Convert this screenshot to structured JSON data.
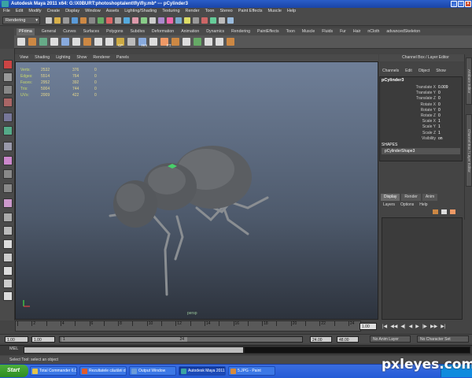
{
  "window": {
    "title": "Autodesk Maya 2011 x64: G:\\X0BURT:photoshoptalent\\fly\\fly.mb*   ---   pCylinder3"
  },
  "menubar": [
    "File",
    "Edit",
    "Modify",
    "Create",
    "Display",
    "Window",
    "Assets",
    "Lighting/Shading",
    "Texturing",
    "Render",
    "Toon",
    "Stereo",
    "Paint Effects",
    "Muscle",
    "Help"
  ],
  "status_line": {
    "mode": "Rendering"
  },
  "shelf_tabs": [
    "PFrima",
    "General",
    "Curves",
    "Surfaces",
    "Polygons",
    "Subdivs",
    "Deformation",
    "Animation",
    "Dynamics",
    "Rendering",
    "PaintEffects",
    "Toon",
    "Muscle",
    "Fluids",
    "Fur",
    "Hair",
    "nCloth",
    "advancedSkeleton"
  ],
  "shelf_icon_labels": [
    "CP",
    "Hrn",
    "FT"
  ],
  "panel_menu": [
    "View",
    "Shading",
    "Lighting",
    "Show",
    "Renderer",
    "Panels"
  ],
  "hud": [
    {
      "label": "Verts:",
      "a": "2532",
      "b": "376",
      "c": "0"
    },
    {
      "label": "Edges:",
      "a": "5514",
      "b": "764",
      "c": "0"
    },
    {
      "label": "Faces:",
      "a": "2952",
      "b": "392",
      "c": "0"
    },
    {
      "label": "Tris:",
      "a": "5004",
      "b": "744",
      "c": "0"
    },
    {
      "label": "UVs:",
      "a": "2009",
      "b": "422",
      "c": "0"
    }
  ],
  "viewport_label": "persp",
  "channel_box": {
    "header": "Channel Box / Layer Editor",
    "menu": [
      "Channels",
      "Edit",
      "Object",
      "Show"
    ],
    "object": "pCylinder3",
    "attrs": [
      {
        "name": "Translate X",
        "value": "0.009"
      },
      {
        "name": "Translate Y",
        "value": "0"
      },
      {
        "name": "Translate Z",
        "value": "0"
      },
      {
        "name": "Rotate X",
        "value": "0"
      },
      {
        "name": "Rotate Y",
        "value": "0"
      },
      {
        "name": "Rotate Z",
        "value": "0"
      },
      {
        "name": "Scale X",
        "value": "1"
      },
      {
        "name": "Scale Y",
        "value": "1"
      },
      {
        "name": "Scale Z",
        "value": "1"
      },
      {
        "name": "Visibility",
        "value": "on"
      }
    ],
    "shapes_header": "SHAPES",
    "shape_name": "pCylinderShape3"
  },
  "side_tabs": [
    "Attribute Editor",
    "Channel Box / Layer Editor"
  ],
  "layer_editor": {
    "tabs": [
      "Display",
      "Render",
      "Anim"
    ],
    "menu": [
      "Layers",
      "Options",
      "Help"
    ]
  },
  "timeline": {
    "ticks": [
      "2",
      "4",
      "6",
      "8",
      "10",
      "12",
      "14",
      "16",
      "18",
      "20",
      "22",
      "24"
    ],
    "current": "1.00"
  },
  "playback_icons": [
    "|◀",
    "◀◀",
    "◀|",
    "◀",
    "▶",
    "|▶",
    "▶▶",
    "▶|"
  ],
  "range": {
    "start": "1.00",
    "start2": "1.00",
    "slider_start": "1",
    "slider_end": "24",
    "end": "24.00",
    "end2": "48.00",
    "anim_layer": "No Anim Layer",
    "character": "No Character Set"
  },
  "mel": {
    "label": "MEL"
  },
  "help_line": "Select Tool: select an object",
  "taskbar": {
    "start": "Start",
    "tasks": [
      {
        "label": "Total Commander 6.03 - ...",
        "color": "#e3c34a"
      },
      {
        "label": "Rezultatele căutării de ...",
        "color": "#e05a2a"
      },
      {
        "label": "Output Window",
        "color": "#6a9bd8"
      },
      {
        "label": "Autodesk Maya 2011 ...",
        "color": "#3aa3a3"
      },
      {
        "label": "5.JPG - Paint",
        "color": "#d88a3a"
      }
    ]
  },
  "watermark": "pxleyes.com",
  "colors": {
    "accent": "#2a5ec9",
    "viewport_top": "#6f7f98",
    "viewport_bottom": "#2d333d"
  }
}
